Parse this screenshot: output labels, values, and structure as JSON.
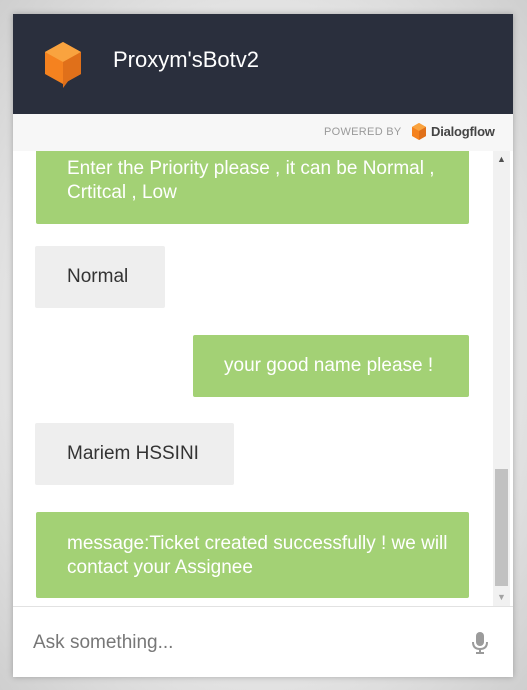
{
  "header": {
    "title": "Proxym'sBotv2"
  },
  "powered": {
    "label": "POWERED BY",
    "brand": "Dialogflow"
  },
  "messages": [
    {
      "from": "bot",
      "text": "Enter the Priority please , it can be Normal , Crtitcal , Low"
    },
    {
      "from": "user",
      "text": "Normal"
    },
    {
      "from": "bot",
      "text": "your good name please !"
    },
    {
      "from": "user",
      "text": "Mariem HSSINI"
    },
    {
      "from": "bot",
      "text": "message:Ticket created successfully ! we will contact your Assignee"
    }
  ],
  "input": {
    "placeholder": "Ask something..."
  },
  "colors": {
    "header_bg": "#2a2f3d",
    "bot_bubble": "#a3d175",
    "user_bubble": "#eeeeee",
    "logo_orange": "#f5821f"
  },
  "icons": {
    "logo": "dialogflow-cube-icon",
    "brand": "dialogflow-icon",
    "mic": "microphone-icon",
    "scroll_up": "scroll-up-arrow",
    "scroll_down": "scroll-down-arrow"
  }
}
